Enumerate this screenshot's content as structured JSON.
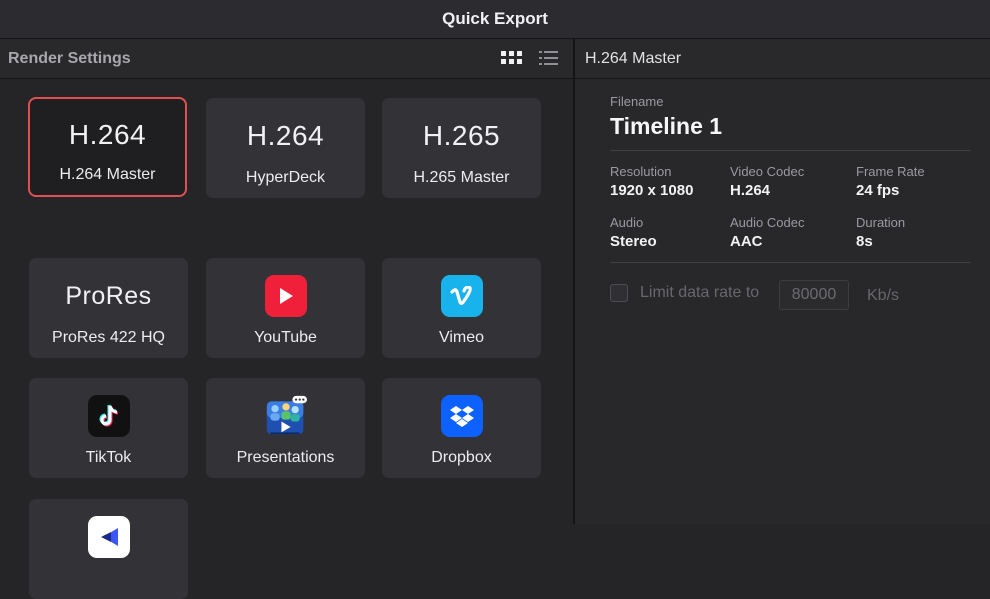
{
  "window": {
    "title": "Quick Export"
  },
  "render_settings": {
    "title": "Render Settings",
    "view_modes": [
      "grid",
      "list"
    ],
    "presets": [
      {
        "big": "H.264",
        "label": "H.264 Master",
        "selected": true
      },
      {
        "big": "H.264",
        "label": "HyperDeck"
      },
      {
        "big": "H.265",
        "label": "H.265 Master"
      },
      {
        "big": "ProRes",
        "label": "ProRes 422 HQ"
      },
      {
        "icon": "youtube-icon",
        "label": "YouTube",
        "color": "#f0203a"
      },
      {
        "icon": "vimeo-icon",
        "label": "Vimeo",
        "color": "#18b3ec"
      },
      {
        "icon": "tiktok-icon",
        "label": "TikTok",
        "color": "#111111"
      },
      {
        "icon": "presentations-icon",
        "label": "Presentations"
      },
      {
        "icon": "dropbox-icon",
        "label": "Dropbox",
        "color": "#0d61ff"
      },
      {
        "icon": "frameio-icon",
        "label": "",
        "color": "#ffffff"
      }
    ]
  },
  "details": {
    "title": "H.264 Master",
    "filename_label": "Filename",
    "filename": "Timeline 1",
    "resolution_label": "Resolution",
    "resolution": "1920 x 1080",
    "video_codec_label": "Video Codec",
    "video_codec": "H.264",
    "frame_rate_label": "Frame Rate",
    "frame_rate": "24 fps",
    "audio_label": "Audio",
    "audio": "Stereo",
    "audio_codec_label": "Audio Codec",
    "audio_codec": "AAC",
    "duration_label": "Duration",
    "duration": "8s",
    "limit_label": "Limit data rate to",
    "limit_checked": false,
    "limit_value": "80000",
    "limit_unit": "Kb/s"
  },
  "colors": {
    "selected_border": "#e05050",
    "tile_bg": "#333337",
    "background": "#252528"
  }
}
